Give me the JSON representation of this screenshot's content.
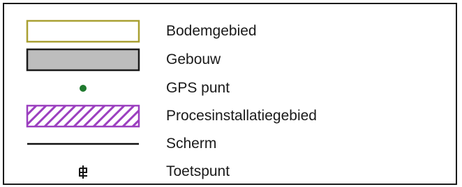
{
  "legend": {
    "items": [
      {
        "label": "Bodemgebied",
        "symbol": "yellow-outline-rectangle-icon",
        "color": "#a9a032"
      },
      {
        "label": "Gebouw",
        "symbol": "grey-filled-rectangle-icon",
        "color": "#bdbdbd"
      },
      {
        "label": "GPS punt",
        "symbol": "green-dot-icon",
        "color": "#1f7a2e"
      },
      {
        "label": "Procesinstallatiegebied",
        "symbol": "purple-hatched-rectangle-icon",
        "color": "#9b3fbf"
      },
      {
        "label": "Scherm",
        "symbol": "black-line-icon",
        "color": "#111111"
      },
      {
        "label": "Toetspunt",
        "symbol": "toetspunt-marker-icon",
        "color": "#111111"
      }
    ]
  }
}
